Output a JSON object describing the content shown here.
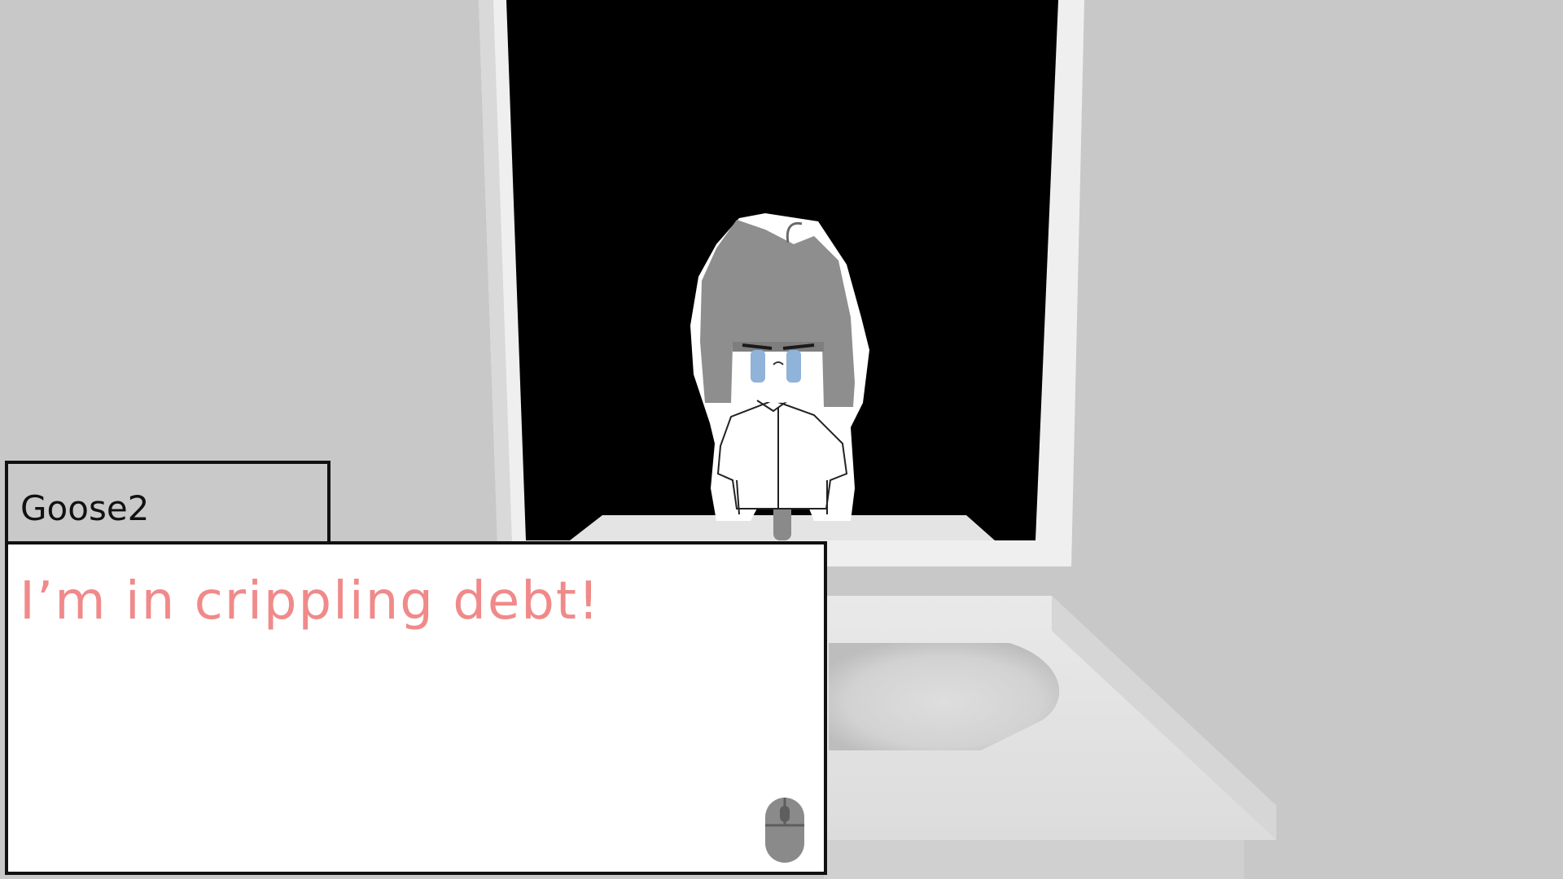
{
  "dialogue": {
    "speaker": "Goose2",
    "line": "I’m in crippling debt!",
    "line_color": "#f08a8a"
  },
  "colors": {
    "wall": "#c8c8c8",
    "mirror_glass": "#000000",
    "frame": "#eeeeee",
    "sink": "#e6e6e6"
  },
  "icons": {
    "advance": "mouse-icon"
  }
}
